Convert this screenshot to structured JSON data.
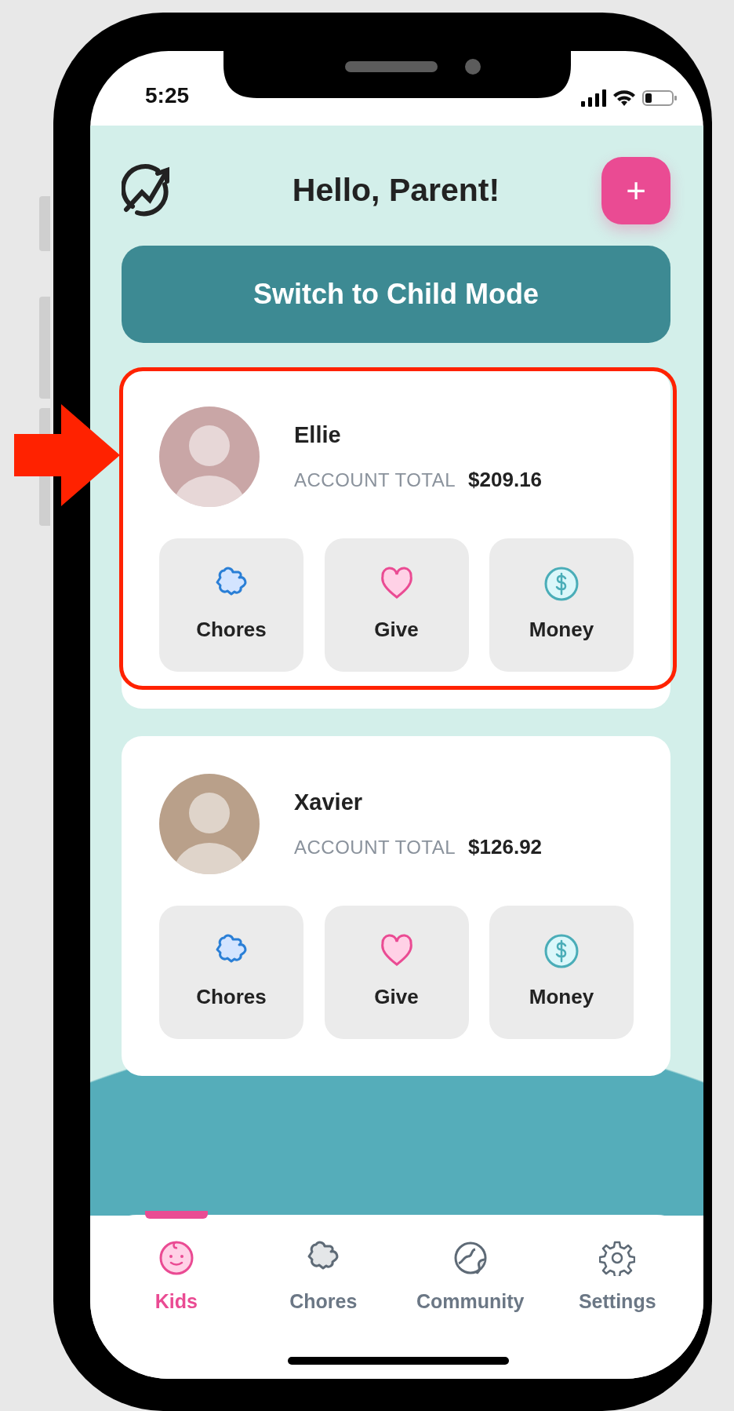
{
  "status_bar": {
    "time": "5:25"
  },
  "header": {
    "title": "Hello, Parent!",
    "add_button": "+"
  },
  "mode_button": "Switch to Child Mode",
  "kids": [
    {
      "name": "Ellie",
      "total_label": "ACCOUNT TOTAL",
      "total": "$209.16",
      "highlighted": true,
      "actions": [
        {
          "kind": "chores",
          "label": "Chores"
        },
        {
          "kind": "give",
          "label": "Give"
        },
        {
          "kind": "money",
          "label": "Money"
        }
      ]
    },
    {
      "name": "Xavier",
      "total_label": "ACCOUNT TOTAL",
      "total": "$126.92",
      "highlighted": false,
      "actions": [
        {
          "kind": "chores",
          "label": "Chores"
        },
        {
          "kind": "give",
          "label": "Give"
        },
        {
          "kind": "money",
          "label": "Money"
        }
      ]
    }
  ],
  "nav": [
    {
      "kind": "kids",
      "label": "Kids",
      "selected": true
    },
    {
      "kind": "chores",
      "label": "Chores",
      "selected": false
    },
    {
      "kind": "community",
      "label": "Community",
      "selected": false
    },
    {
      "kind": "settings",
      "label": "Settings",
      "selected": false
    }
  ]
}
